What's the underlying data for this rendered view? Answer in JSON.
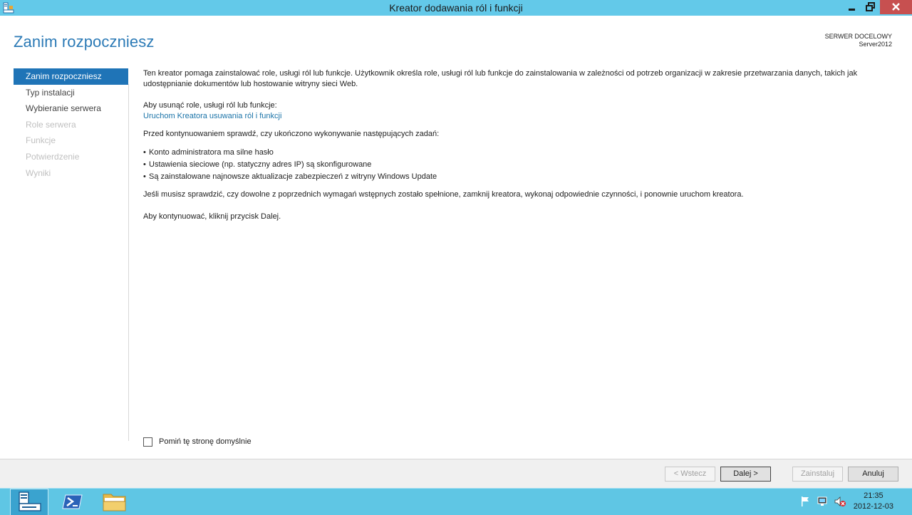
{
  "window": {
    "title": "Kreator dodawania ról i funkcji"
  },
  "page": {
    "title": "Zanim rozpoczniesz",
    "target_label": "SERWER DOCELOWY",
    "target_value": "Server2012"
  },
  "nav": {
    "items": [
      {
        "label": "Zanim rozpoczniesz",
        "state": "active"
      },
      {
        "label": "Typ instalacji",
        "state": "enabled"
      },
      {
        "label": "Wybieranie serwera",
        "state": "enabled"
      },
      {
        "label": "Role serwera",
        "state": "disabled"
      },
      {
        "label": "Funkcje",
        "state": "disabled"
      },
      {
        "label": "Potwierdzenie",
        "state": "disabled"
      },
      {
        "label": "Wyniki",
        "state": "disabled"
      }
    ]
  },
  "content": {
    "intro": "Ten kreator pomaga zainstalować role, usługi ról lub funkcje. Użytkownik określa role, usługi ról lub funkcje do zainstalowania w zależności od potrzeb organizacji w zakresie przetwarzania danych, takich jak udostępnianie dokumentów lub hostowanie witryny sieci Web.",
    "remove_label": "Aby usunąć role, usługi ról lub funkcje:",
    "remove_link": "Uruchom Kreatora usuwania ról i funkcji",
    "prereq_intro": "Przed kontynuowaniem sprawdź, czy ukończono wykonywanie następujących zadań:",
    "bullets": [
      "Konto administratora ma silne hasło",
      "Ustawienia sieciowe (np. statyczny adres IP) są skonfigurowane",
      "Są zainstalowane najnowsze aktualizacje zabezpieczeń z witryny Windows Update"
    ],
    "verify_note": "Jeśli musisz sprawdzić, czy dowolne z poprzednich wymagań wstępnych zostało spełnione, zamknij kreatora, wykonaj odpowiednie czynności, i ponownie uruchom kreatora.",
    "continue_note": "Aby kontynuować, kliknij przycisk Dalej.",
    "skip_label": "Pomiń tę stronę domyślnie",
    "skip_checked": false
  },
  "buttons": {
    "back": "< Wstecz",
    "next": "Dalej >",
    "install": "Zainstaluj",
    "cancel": "Anuluj"
  },
  "clock": {
    "time": "21:35",
    "date": "2012-12-03"
  },
  "colors": {
    "accent": "#1f74b7",
    "title_text": "#2b7ab6",
    "titlebar": "#63c9e9",
    "close_button": "#c75050",
    "taskbar": "#5fc6e4"
  },
  "icons": {
    "app": "server-manager-icon",
    "minimize": "minimize-icon",
    "restore": "restore-icon",
    "close": "close-icon",
    "taskbar_server_manager": "server-manager-icon",
    "taskbar_powershell": "powershell-icon",
    "taskbar_explorer": "folder-icon",
    "tray_flag": "action-center-flag-icon",
    "tray_network": "network-icon",
    "tray_volume": "volume-muted-icon"
  }
}
